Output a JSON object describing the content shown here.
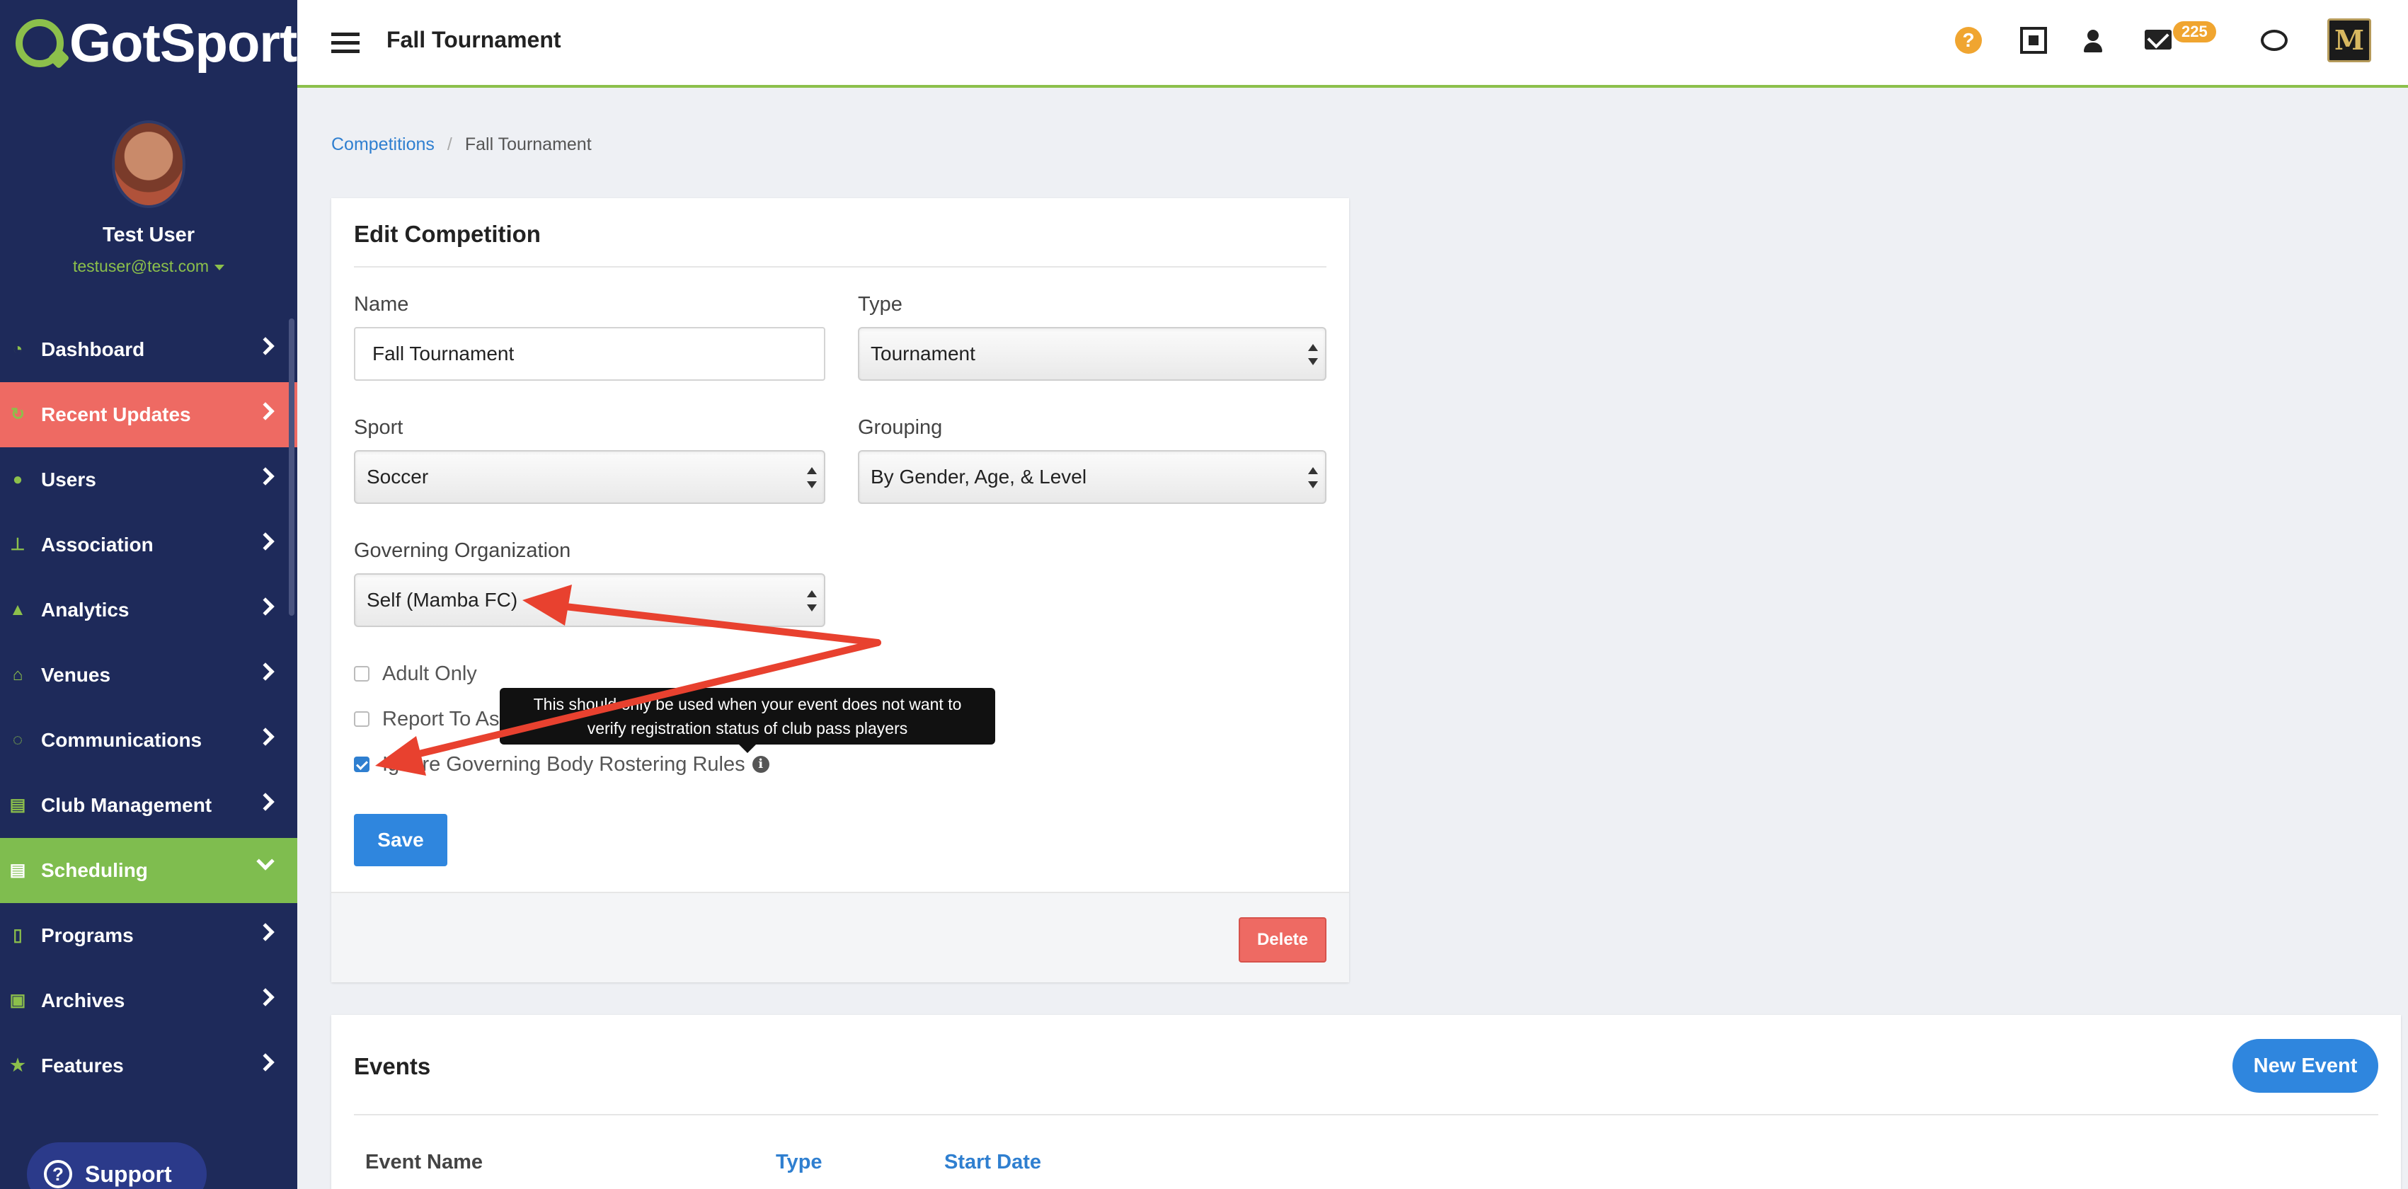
{
  "brand": {
    "logo_text": "GotSport"
  },
  "user": {
    "name": "Test User",
    "email": "testuser@test.com"
  },
  "sidebar": {
    "items": [
      {
        "label": "Dashboard",
        "icon": "dashboard-icon",
        "state": "normal"
      },
      {
        "label": "Recent Updates",
        "icon": "refresh-icon",
        "state": "highlight"
      },
      {
        "label": "Users",
        "icon": "users-icon",
        "state": "normal"
      },
      {
        "label": "Association",
        "icon": "sitemap-icon",
        "state": "normal"
      },
      {
        "label": "Analytics",
        "icon": "area-chart-icon",
        "state": "normal"
      },
      {
        "label": "Venues",
        "icon": "home-icon",
        "state": "normal"
      },
      {
        "label": "Communications",
        "icon": "comments-icon",
        "state": "normal"
      },
      {
        "label": "Club Management",
        "icon": "list-icon",
        "state": "normal"
      },
      {
        "label": "Scheduling",
        "icon": "calendar-list-icon",
        "state": "active"
      },
      {
        "label": "Programs",
        "icon": "file-icon",
        "state": "normal"
      },
      {
        "label": "Archives",
        "icon": "archive-icon",
        "state": "normal"
      },
      {
        "label": "Features",
        "icon": "star-icon",
        "state": "normal"
      }
    ],
    "support_label": "Support"
  },
  "header": {
    "title": "Fall Tournament",
    "mail_count": "225",
    "brand_avatar_letter": "M"
  },
  "breadcrumb": {
    "root": "Competitions",
    "current": "Fall Tournament"
  },
  "edit_form": {
    "title": "Edit Competition",
    "name_label": "Name",
    "name_value": "Fall Tournament",
    "type_label": "Type",
    "type_value": "Tournament",
    "sport_label": "Sport",
    "sport_value": "Soccer",
    "grouping_label": "Grouping",
    "grouping_value": "By Gender, Age, & Level",
    "governing_label": "Governing Organization",
    "governing_value": "Self (Mamba FC)",
    "adult_only_label": "Adult Only",
    "adult_only_checked": false,
    "report_label": "Report To Ass",
    "report_checked": false,
    "ignore_rules_label": "Ignore Governing Body Rostering Rules",
    "ignore_rules_checked": true,
    "tooltip_line1": "This should only be used when your event does not want to",
    "tooltip_line2": "verify registration status of club pass players",
    "save_label": "Save",
    "delete_label": "Delete"
  },
  "events": {
    "title": "Events",
    "new_event_label": "New Event",
    "columns": [
      {
        "label": "Event Name",
        "style": "plain"
      },
      {
        "label": "Type",
        "style": "link"
      },
      {
        "label": "Start Date",
        "style": "link"
      }
    ]
  },
  "colors": {
    "sidebar_bg": "#1e2a5a",
    "accent_green": "#8cc04b",
    "highlight_red": "#ee6a63",
    "active_green": "#7fbd4f",
    "primary_blue": "#2f86de",
    "annotation_red": "#e8412f"
  }
}
